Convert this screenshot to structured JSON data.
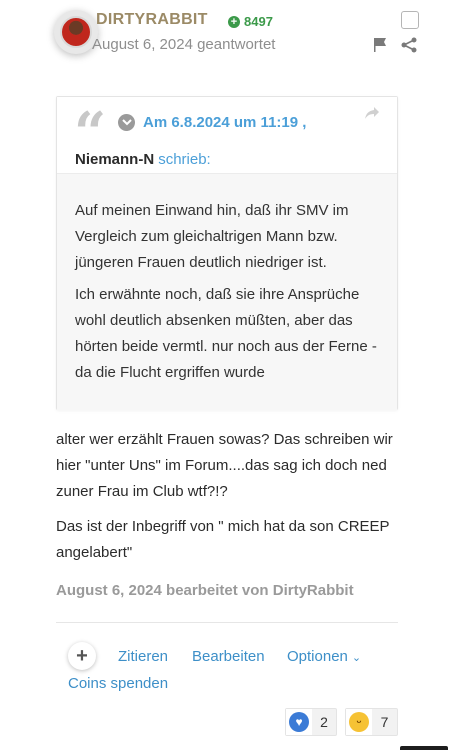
{
  "post": {
    "username": "DIRTYRABBIT",
    "reputation": "8497",
    "date_action": "August 6, 2024 geantwortet",
    "edited_note": "August 6, 2024 bearbeitet von DirtyRabbit"
  },
  "quote": {
    "timestamp": "Am 6.8.2024 um 11:19 ,",
    "author": "Niemann-N",
    "wrote": "schrieb:",
    "paragraphs": [
      "Auf meinen Einwand hin, daß ihr SMV im Vergleich zum gleichaltrigen Mann bzw. jüngeren Frauen deutlich niedriger ist.",
      "Ich erwähnte noch, daß sie ihre Ansprüche wohl deutlich absenken müßten, aber das hörten beide vermtl. nur noch aus der Ferne - da die Flucht ergriffen wurde"
    ]
  },
  "content": {
    "paragraphs": [
      "alter wer erzählt Frauen sowas? Das schreiben wir hier \"unter Uns\" im Forum....das sag ich doch ned zuner Frau im Club wtf?!?",
      "Das ist der Inbegriff von \" mich hat da son CREEP angelabert\""
    ]
  },
  "actions": {
    "plus": "+",
    "quote": "Zitieren",
    "edit": "Bearbeiten",
    "options": "Optionen",
    "coins": "Coins spenden"
  },
  "reactions": [
    {
      "icon": "heart-icon",
      "count": "2"
    },
    {
      "icon": "laugh-icon",
      "count": "7"
    }
  ],
  "colors": {
    "accent": "#4b9fd8",
    "username": "#9b8a66",
    "reputation": "#3c9a4a"
  }
}
